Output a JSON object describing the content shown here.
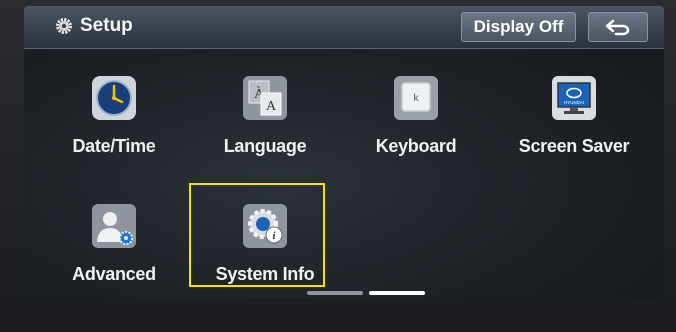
{
  "header": {
    "title": "Setup",
    "title_icon": "gear-icon",
    "display_off_label": "Display Off",
    "back_icon": "back-arrow-icon"
  },
  "tiles": [
    {
      "label": "Date/Time",
      "icon": "clock-icon"
    },
    {
      "label": "Language",
      "icon": "language-icon"
    },
    {
      "label": "Keyboard",
      "icon": "keyboard-icon"
    },
    {
      "label": "Screen Saver",
      "icon": "screen-saver-icon"
    },
    {
      "label": "Advanced",
      "icon": "advanced-user-icon"
    },
    {
      "label": "System Info",
      "icon": "system-info-icon"
    }
  ],
  "highlighted_tile": "System Info",
  "pagination": {
    "pages": 2,
    "current": 2
  },
  "colors": {
    "highlight": "#f5e400",
    "screen_bg": "#1d2126",
    "text": "#f0f0f0"
  }
}
